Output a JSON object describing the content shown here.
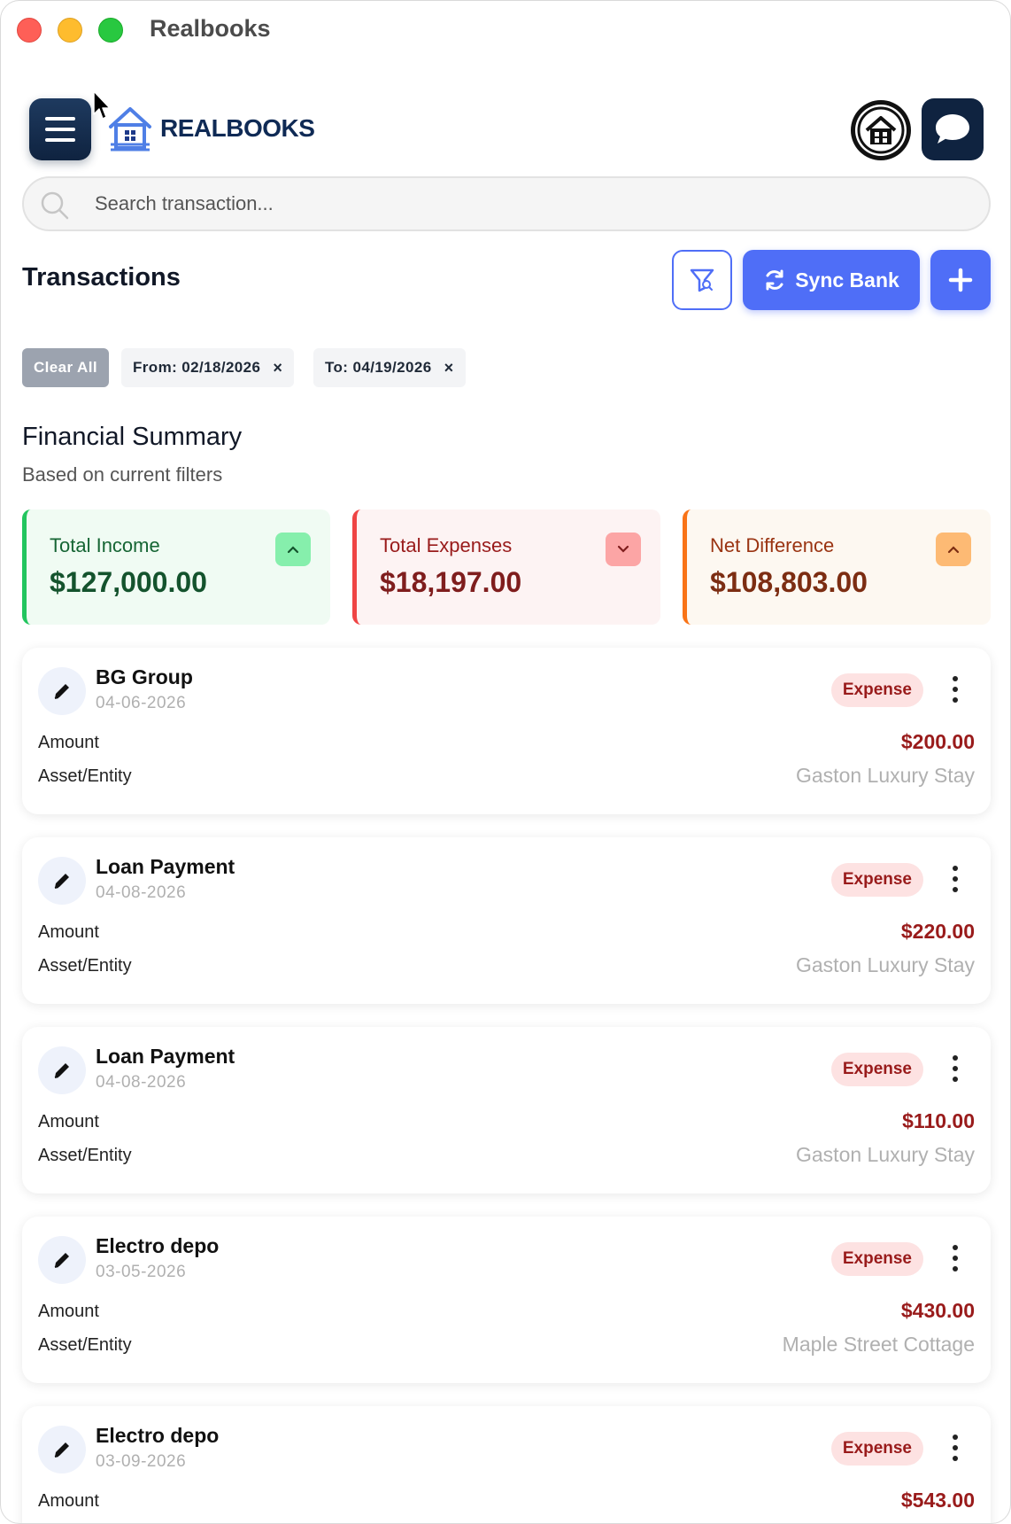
{
  "window": {
    "title": "Realbooks"
  },
  "header": {
    "logo_text": "REALBOOKS"
  },
  "search": {
    "placeholder": "Search transaction..."
  },
  "page": {
    "title": "Transactions",
    "sync_label": "Sync Bank"
  },
  "filters": {
    "clear_label": "Clear All",
    "from_label": "From: 02/18/2026",
    "to_label": "To: 04/19/2026",
    "remove_glyph": "×"
  },
  "summary": {
    "title": "Financial Summary",
    "subtitle": "Based on current filters",
    "cards": [
      {
        "label": "Total Income",
        "value": "$127,000.00",
        "badge": "up",
        "accent": "#22c55e"
      },
      {
        "label": "Total Expenses",
        "value": "$18,197.00",
        "badge": "down",
        "accent": "#ef4444"
      },
      {
        "label": "Net Difference",
        "value": "$108,803.00",
        "badge": "up",
        "accent": "#f97316"
      }
    ]
  },
  "transactions": {
    "amount_label": "Amount",
    "entity_label": "Asset/Entity",
    "items": [
      {
        "name": "BG Group",
        "date": "04-06-2026",
        "type": "Expense",
        "amount": "$200.00",
        "entity": "Gaston Luxury Stay"
      },
      {
        "name": "Loan Payment",
        "date": "04-08-2026",
        "type": "Expense",
        "amount": "$220.00",
        "entity": "Gaston Luxury Stay"
      },
      {
        "name": "Loan Payment",
        "date": "04-08-2026",
        "type": "Expense",
        "amount": "$110.00",
        "entity": "Gaston Luxury Stay"
      },
      {
        "name": "Electro depo",
        "date": "03-05-2026",
        "type": "Expense",
        "amount": "$430.00",
        "entity": "Maple Street Cottage"
      },
      {
        "name": "Electro depo",
        "date": "03-09-2026",
        "type": "Expense",
        "amount": "$543.00",
        "entity": ""
      }
    ]
  },
  "colors": {
    "primary": "#4f6ef7",
    "navy": "#0f2340",
    "expense": "#991b1b"
  }
}
